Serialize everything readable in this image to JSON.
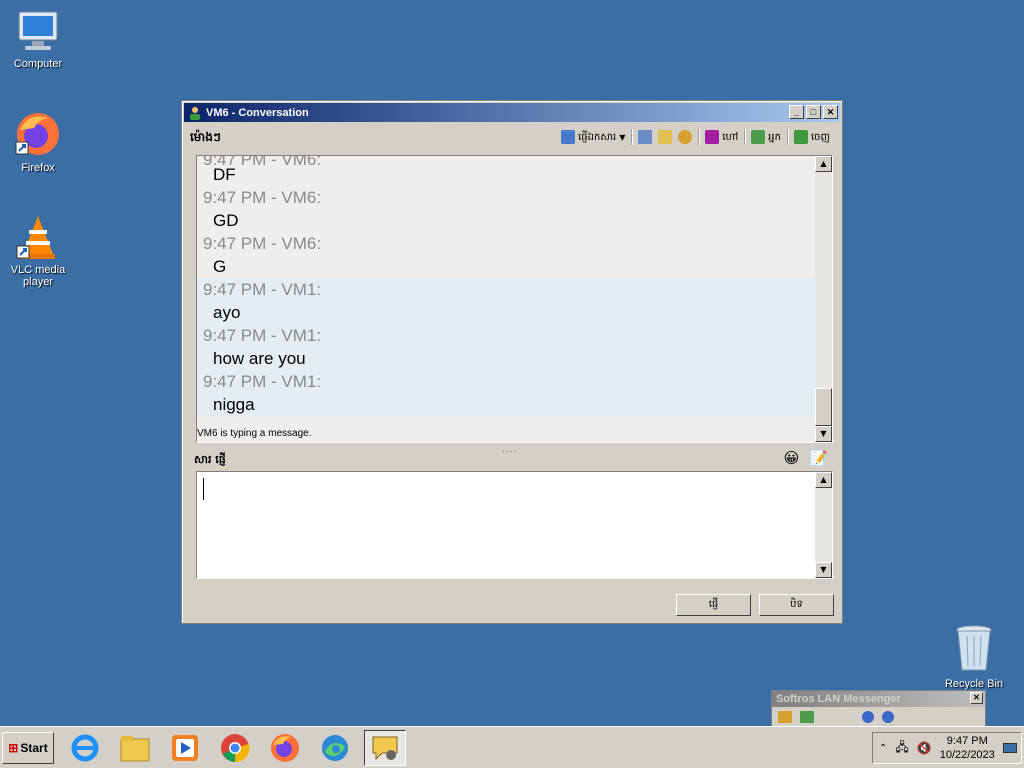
{
  "desktop": {
    "icons": [
      {
        "label": "Computer"
      },
      {
        "label": "Firefox"
      },
      {
        "label": "VLC media player"
      },
      {
        "label": "Recycle Bin"
      }
    ]
  },
  "window": {
    "title": "VM6 - Conversation",
    "toolbar_label": "ម៉ោងៗ",
    "toolbar_items": [
      "ផ្ញើឯកសារ",
      "ហៅ",
      "អ្នក",
      "ចេញ"
    ],
    "messages": [
      {
        "meta": "9:47 PM - VM6:",
        "text": "DF",
        "sender": "VM6"
      },
      {
        "meta": "9:47 PM - VM6:",
        "text": "GD",
        "sender": "VM6"
      },
      {
        "meta": "9:47 PM - VM6:",
        "text": "G",
        "sender": "VM6"
      },
      {
        "meta": "9:47 PM - VM1:",
        "text": "ayo",
        "sender": "VM1"
      },
      {
        "meta": "9:47 PM - VM1:",
        "text": "how are you",
        "sender": "VM1"
      },
      {
        "meta": "9:47 PM - VM1:",
        "text": "nigga",
        "sender": "VM1"
      }
    ],
    "top_partial_meta": "9:47 PM - VM6:",
    "typing_status": "VM6 is typing a message.",
    "splitter": "....",
    "compose_label": "សារ ផ្ញើ",
    "send_button": "ផ្ញើ",
    "close_button": "បិទ"
  },
  "mini_window": {
    "title": "Softros LAN Messenger"
  },
  "taskbar": {
    "start_label": "Start",
    "clock_time": "9:47 PM",
    "clock_date": "10/22/2023"
  },
  "colors": {
    "desktop_bg": "#3a6ea5",
    "title_active_start": "#0a246a",
    "title_active_end": "#a6caf0",
    "vm1_highlight": "#e4ecf4"
  }
}
